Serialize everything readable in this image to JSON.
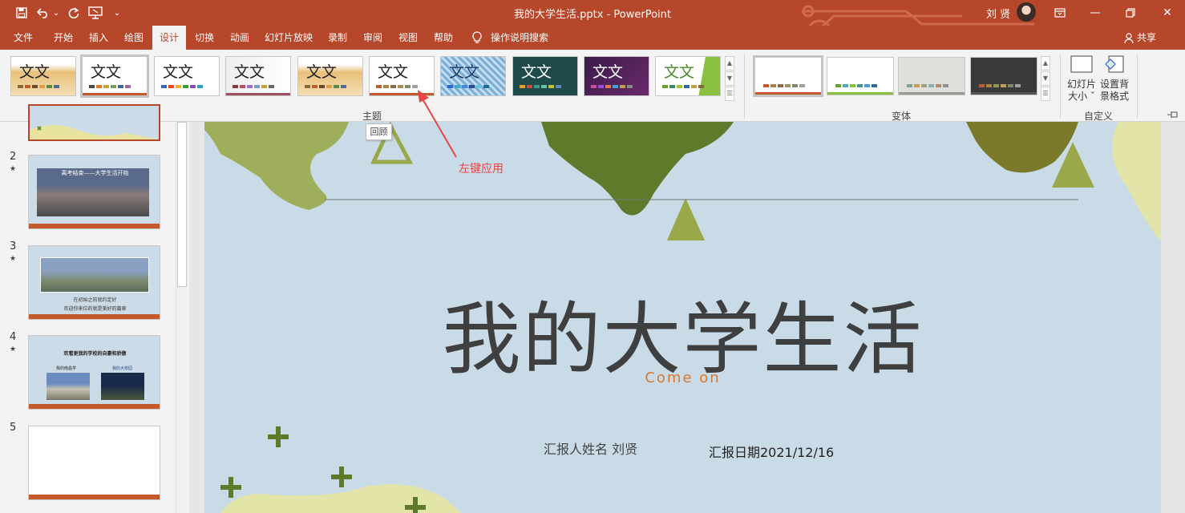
{
  "window": {
    "doc_title": "我的大学生活.pptx  -  PowerPoint",
    "user": "刘 贤",
    "qat_dropdown": "⌄",
    "minimize": "—",
    "close": "✕"
  },
  "menu": {
    "tabs": [
      "文件",
      "开始",
      "插入",
      "绘图",
      "设计",
      "切换",
      "动画",
      "幻灯片放映",
      "录制",
      "审阅",
      "视图",
      "帮助"
    ],
    "active_tab": "设计",
    "tell_me": "操作说明搜索",
    "share": "共享"
  },
  "ribbon": {
    "theme_sample_text": "文文",
    "themes_label": "主题",
    "variants_label": "变体",
    "customize_label": "自定义",
    "slide_size_label": "幻灯片大小",
    "slide_size_line1": "幻灯片",
    "slide_size_line2": "大小 ˇ",
    "format_bg_line1": "设置背",
    "format_bg_line2": "景格式",
    "tooltip": "回顾",
    "colors": {
      "brand": "#b7472a",
      "accent_red": "#e84545"
    }
  },
  "annotation": "左键应用",
  "thumbnails": [
    {
      "num": "2",
      "title": "离考结束——大学生活开始"
    },
    {
      "num": "3",
      "line1": "在初始之前就约定好",
      "line2": "欢迎你来位的就是美好的篇章"
    },
    {
      "num": "4",
      "title": "欢看更我的学校的自豪和骄傲",
      "left": "我的南昌学",
      "right": "我的大校园"
    },
    {
      "num": "5"
    }
  ],
  "slide": {
    "title": "我的大学生活",
    "subtitle": "Come on",
    "presenter": "汇报人姓名 刘贤",
    "date": "汇报日期2021/12/16"
  }
}
